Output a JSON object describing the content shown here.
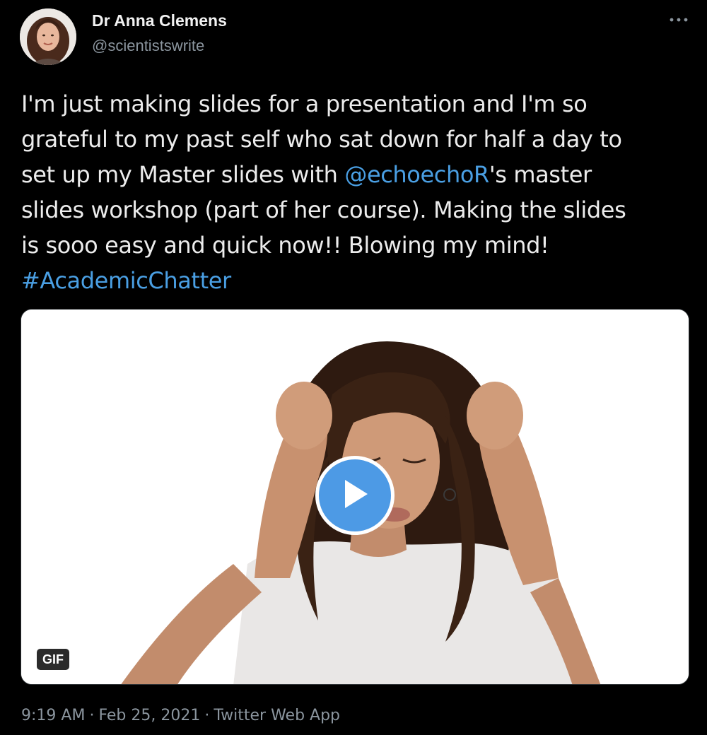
{
  "author": {
    "name": "Dr Anna Clemens",
    "handle": "@scientistswrite"
  },
  "tweet": {
    "line1": "I'm just making slides for a presentation and I'm so",
    "line2": "grateful to my past self who sat down for half a day to",
    "line3_before": "set up my Master slides with ",
    "mention": "@echoechoR",
    "line3_after": "'s master",
    "line4": "slides workshop (part of her course). Making the slides",
    "line5": "is sooo easy and quick now!! Blowing my mind!",
    "hashtag": "#AcademicChatter"
  },
  "media": {
    "badge": "GIF",
    "play_icon": "play-icon"
  },
  "meta": {
    "time": "9:19 AM",
    "separator": "·",
    "date": "Feb 25, 2021",
    "source": "Twitter Web App"
  },
  "icons": {
    "more": "more-horizontal-icon"
  },
  "colors": {
    "background": "#000000",
    "link": "#4a9fe3",
    "secondary_text": "#8b959e",
    "play_button": "#4d9ae5"
  }
}
